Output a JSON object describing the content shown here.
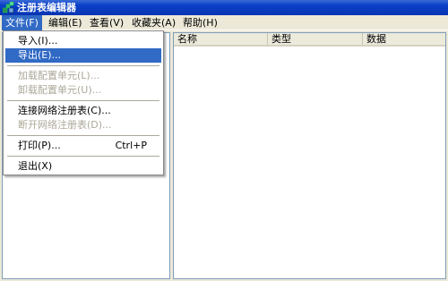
{
  "window": {
    "title": "注册表编辑器",
    "icon": "regedit-icon"
  },
  "menubar": {
    "items": [
      {
        "label": "文件(F)"
      },
      {
        "label": "编辑(E)"
      },
      {
        "label": "查看(V)"
      },
      {
        "label": "收藏夹(A)"
      },
      {
        "label": "帮助(H)"
      }
    ]
  },
  "file_menu": {
    "items": [
      {
        "label": "导入(I)..."
      },
      {
        "label": "导出(E)..."
      },
      {
        "label": "加载配置单元(L)..."
      },
      {
        "label": "卸载配置单元(U)..."
      },
      {
        "label": "连接网络注册表(C)..."
      },
      {
        "label": "断开网络注册表(D)..."
      },
      {
        "label": "打印(P)...",
        "shortcut": "Ctrl+P"
      },
      {
        "label": "退出(X)"
      }
    ]
  },
  "list": {
    "columns": [
      {
        "label": "名称"
      },
      {
        "label": "类型"
      },
      {
        "label": "数据"
      }
    ]
  },
  "colors": {
    "titlebar": "#0a40c8",
    "selection": "#316ac5",
    "menubar": "#ece9d8",
    "disabled": "#aca899"
  }
}
